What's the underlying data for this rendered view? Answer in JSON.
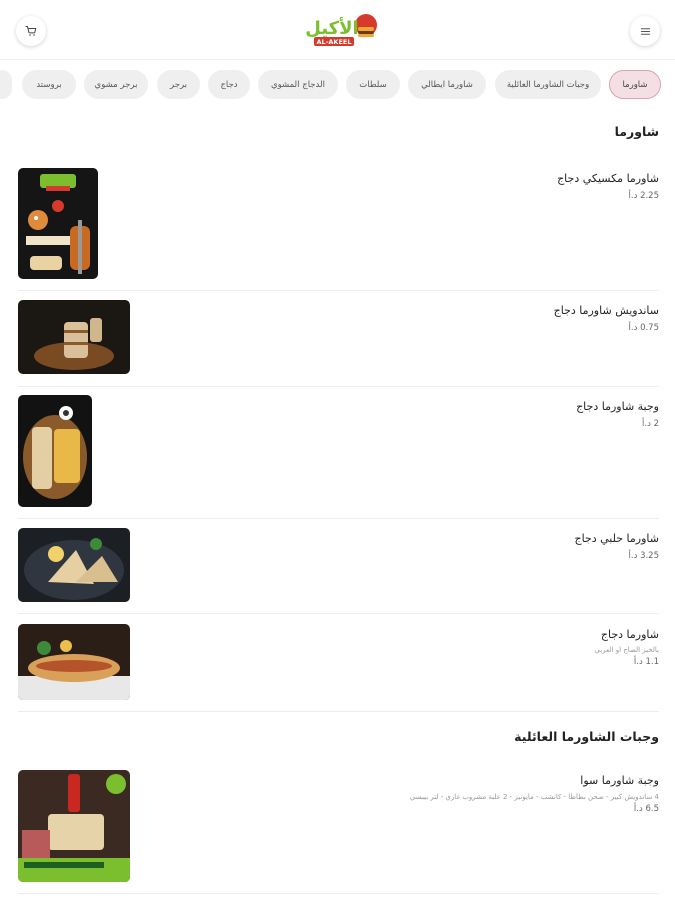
{
  "header": {
    "logo_text": "الأكيل",
    "logo_subtext": "AL-AKEEL",
    "cart_icon": "cart-icon",
    "menu_icon": "hamburger-menu-icon"
  },
  "categories": [
    {
      "label": "شاورما",
      "active": true
    },
    {
      "label": "وجبات الشاورما العائلية",
      "active": false
    },
    {
      "label": "شاورما ايطالي",
      "active": false
    },
    {
      "label": "سلطات",
      "active": false
    },
    {
      "label": "الدجاج المشوي",
      "active": false
    },
    {
      "label": "دجاج",
      "active": false
    },
    {
      "label": "برجر",
      "active": false
    },
    {
      "label": "برجر مشوي",
      "active": false
    },
    {
      "label": "بروستد",
      "active": false
    }
  ],
  "sections": [
    {
      "title": "شاورما",
      "items": [
        {
          "name": "شاورما مكسيكي دجاج",
          "desc": "",
          "price": "2.25 د.أ"
        },
        {
          "name": "ساندويش شاورما دجاج",
          "desc": "",
          "price": "0.75 د.أ"
        },
        {
          "name": "وجبة شاورما دجاج",
          "desc": "",
          "price": "2 د.أ"
        },
        {
          "name": "شاورما حلبي دجاج",
          "desc": "",
          "price": "3.25 د.أ"
        },
        {
          "name": "شاورما دجاج",
          "desc": "بالخبز الصاج او العربي",
          "price": "1.1 د.أ"
        }
      ]
    },
    {
      "title": "وجبات الشاورما العائلية",
      "items": [
        {
          "name": "وجبة شاورما سوا",
          "desc": "4 ساندويش كبير - صحن بطاطا - كاتشب - مايونيز - 2 علبة مشروب غازي - لتر بيبسي",
          "price": "6.5 د.أ"
        }
      ]
    }
  ],
  "colors": {
    "active_chip_bg": "#f3dfe4",
    "active_chip_border": "#d9a4b0",
    "chip_bg": "#efefef",
    "logo_green": "#7cbf2e",
    "logo_red": "#d63a2c"
  }
}
